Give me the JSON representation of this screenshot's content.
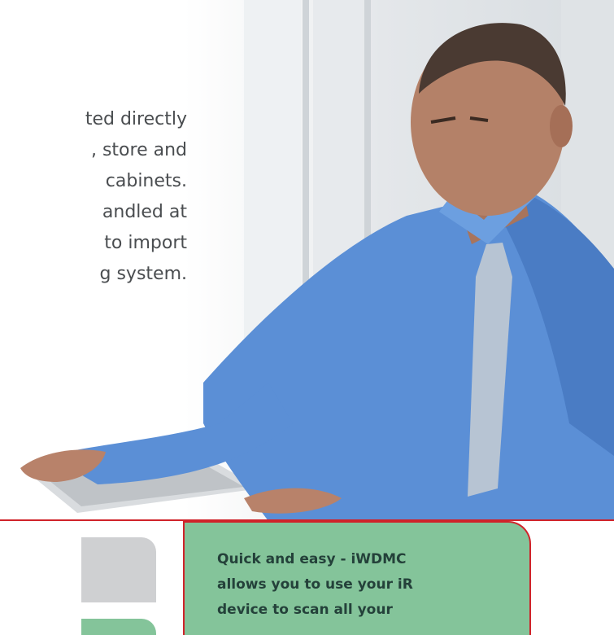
{
  "body_text": {
    "lines": [
      "ted directly",
      ", store and",
      "cabinets.",
      "andled at",
      "to import",
      "g system."
    ]
  },
  "callout": {
    "lines": [
      "Quick and easy - iWDMC",
      "allows you to use your iR",
      "device to scan all your"
    ]
  },
  "colors": {
    "accent_red": "#d0232a",
    "callout_green": "#84c49a",
    "tab_gray": "#cfd0d2",
    "shirt_blue": "#5b8fd6"
  },
  "photo": {
    "subject": "man-at-keyboard-photo"
  }
}
